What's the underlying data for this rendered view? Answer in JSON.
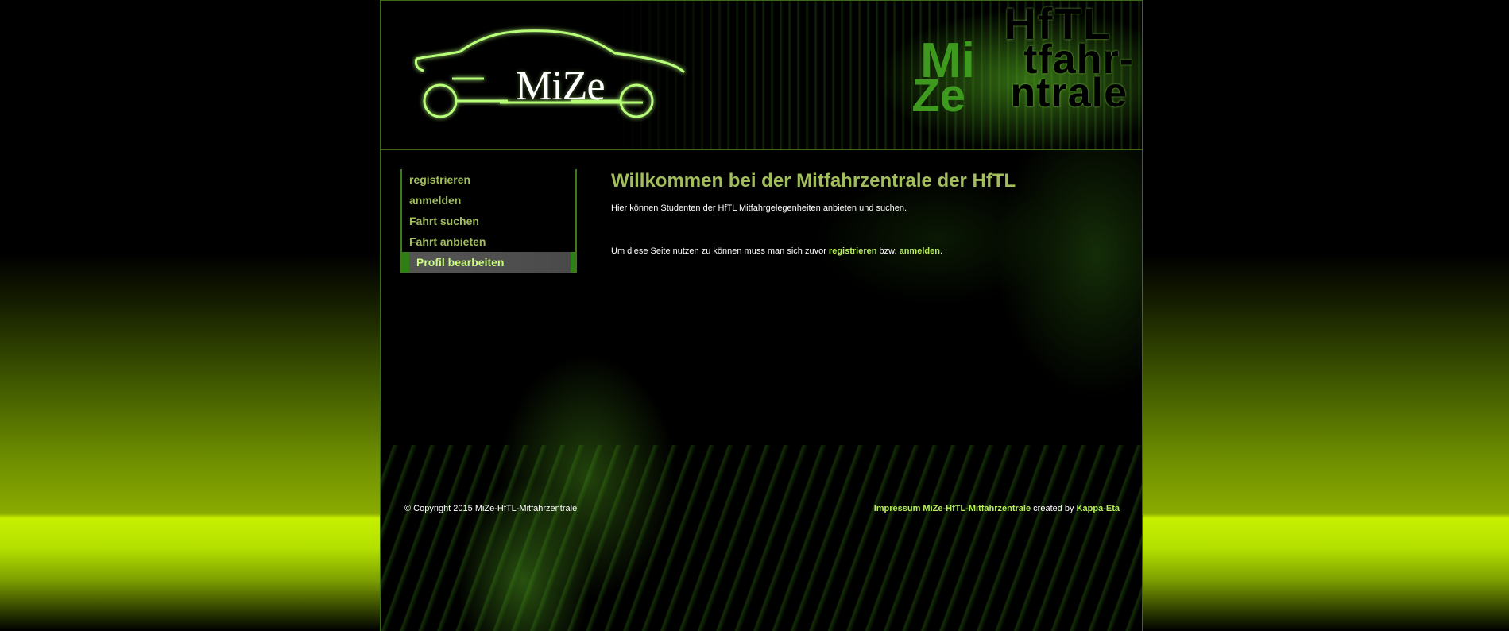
{
  "header": {
    "logo_text": "MiZe",
    "brand_line1": "HfTL",
    "brand_m": "Mi",
    "brand_line2": "tfahr-",
    "brand_z": "Ze",
    "brand_line3": "ntrale"
  },
  "nav": {
    "items": [
      {
        "label": "registrieren"
      },
      {
        "label": "anmelden"
      },
      {
        "label": "Fahrt suchen"
      },
      {
        "label": "Fahrt anbieten"
      },
      {
        "label": "Profil bearbeiten"
      }
    ]
  },
  "content": {
    "title": "Willkommen bei der Mitfahrzentrale der HfTL",
    "intro": "Hier können Studenten der HfTL Mitfahrgelegenheiten anbieten und suchen.",
    "usage_prefix": "Um diese Seite nutzen zu können muss man sich zuvor ",
    "usage_link1": "registrieren",
    "usage_middle": " bzw. ",
    "usage_link2": "anmelden",
    "usage_suffix": "."
  },
  "footer": {
    "copyright": "© Copyright 2015 MiZe-HfTL-Mitfahrzentrale",
    "impressum_link": "Impressum MiZe-HfTL-Mitfahrzentrale",
    "created_by": " created by ",
    "author_link": "Kappa-Eta"
  },
  "colors": {
    "accent_green": "#a2be5c",
    "link_green": "#b6f05a",
    "active_nav_bg": "#4a4a4a"
  }
}
